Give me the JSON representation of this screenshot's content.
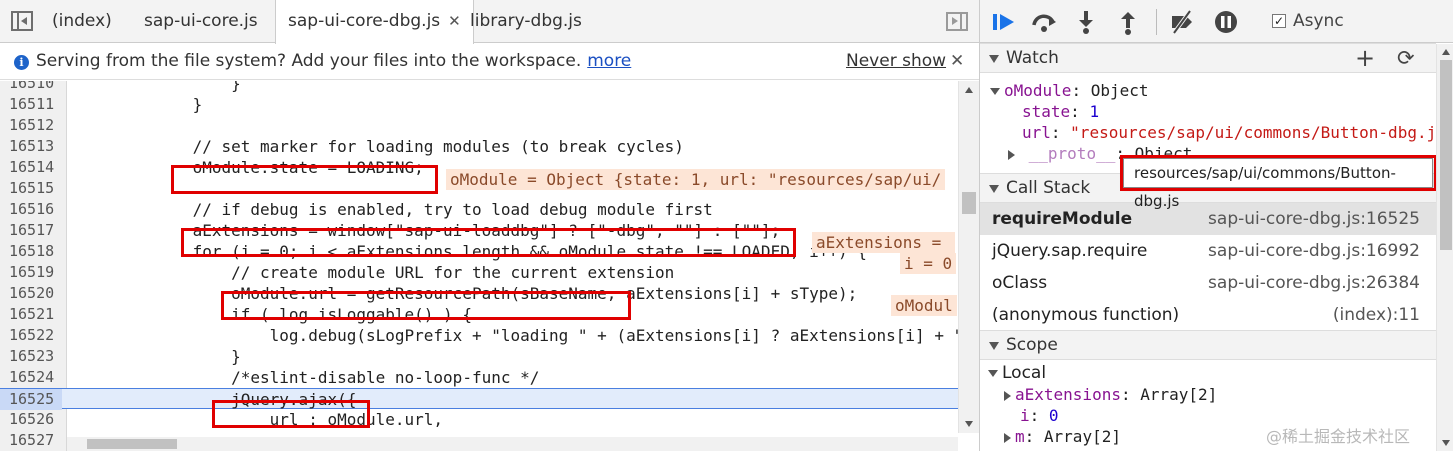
{
  "tabs": [
    {
      "label": "(index)",
      "active": false
    },
    {
      "label": "sap-ui-core.js",
      "active": false
    },
    {
      "label": "sap-ui-core-dbg.js",
      "active": true
    },
    {
      "label": "library-dbg.js",
      "active": false
    }
  ],
  "tab_close_glyph": "✕",
  "infobar": {
    "message": "Serving from the file system? Add your files into the workspace.",
    "more_link": "more",
    "never_show": "Never show",
    "close_glyph": "✕"
  },
  "code": {
    "lines": [
      {
        "num": "16510",
        "text": "                }"
      },
      {
        "num": "16511",
        "text": "            }"
      },
      {
        "num": "16512",
        "text": ""
      },
      {
        "num": "16513",
        "text": "            // set marker for loading modules (to break cycles)"
      },
      {
        "num": "16514",
        "text": "            oModule.state = LOADING;"
      },
      {
        "num": "16515",
        "text": ""
      },
      {
        "num": "16516",
        "text": "            // if debug is enabled, try to load debug module first"
      },
      {
        "num": "16517",
        "text": "            aExtensions = window[\"sap-ui-loaddbg\"] ? [\"-dbg\", \"\"] : [\"\"];"
      },
      {
        "num": "16518",
        "text": "            for (i = 0; i < aExtensions.length && oModule.state !== LOADED; i++) {"
      },
      {
        "num": "16519",
        "text": "                // create module URL for the current extension"
      },
      {
        "num": "16520",
        "text": "                oModule.url = getResourcePath(sBaseName, aExtensions[i] + sType);"
      },
      {
        "num": "16521",
        "text": "                if ( log.isLoggable() ) {"
      },
      {
        "num": "16522",
        "text": "                    log.debug(sLogPrefix + \"loading \" + (aExtensions[i] ? aExtensions[i] + \" version of \" : \"\") + \"'\" + sModuleName"
      },
      {
        "num": "16523",
        "text": "                }"
      },
      {
        "num": "16524",
        "text": "                /*eslint-disable no-loop-func */"
      },
      {
        "num": "16525",
        "text": "                jQuery.ajax({"
      },
      {
        "num": "16526",
        "text": "                    url : oModule.url,"
      },
      {
        "num": "16527",
        "text": ""
      }
    ],
    "inline_values": {
      "l16514": "oModule = Object {state: 1, url: \"resources/sap/ui/",
      "l16517": "aExtensions = ",
      "l16518": "i = 0",
      "l16520": "oModul"
    }
  },
  "debugger": {
    "async_label": "Async",
    "async_checked": "✓",
    "watch": {
      "title": "Watch",
      "add_glyph": "+",
      "refresh_glyph": "⟳",
      "root_name": "oModule",
      "root_value": "Object",
      "props": [
        {
          "name": "state",
          "value": "1"
        },
        {
          "name": "url",
          "value": "\"resources/sap/ui/commons/Button-dbg.js\""
        },
        {
          "name": "__proto__",
          "value": "Object"
        }
      ]
    },
    "tooltip": "resources/sap/ui/commons/Button-dbg.js",
    "call_stack": {
      "title": "Call Stack",
      "frames": [
        {
          "fn": "requireModule",
          "loc": "sap-ui-core-dbg.js:16525",
          "selected": true
        },
        {
          "fn": "jQuery.sap.require",
          "loc": "sap-ui-core-dbg.js:16992",
          "selected": false
        },
        {
          "fn": "oClass",
          "loc": "sap-ui-core-dbg.js:26384",
          "selected": false
        },
        {
          "fn": "(anonymous function)",
          "loc": "(index):11",
          "selected": false
        }
      ]
    },
    "scope": {
      "title": "Scope",
      "local_label": "Local",
      "vars": [
        {
          "name": "aExtensions",
          "value": "Array[2]",
          "expandable": true
        },
        {
          "name": "i",
          "value": "0",
          "expandable": false
        },
        {
          "name": "m",
          "value": "Array[2]",
          "expandable": true
        }
      ]
    }
  },
  "watermark": "@稀土掘金技术社区"
}
